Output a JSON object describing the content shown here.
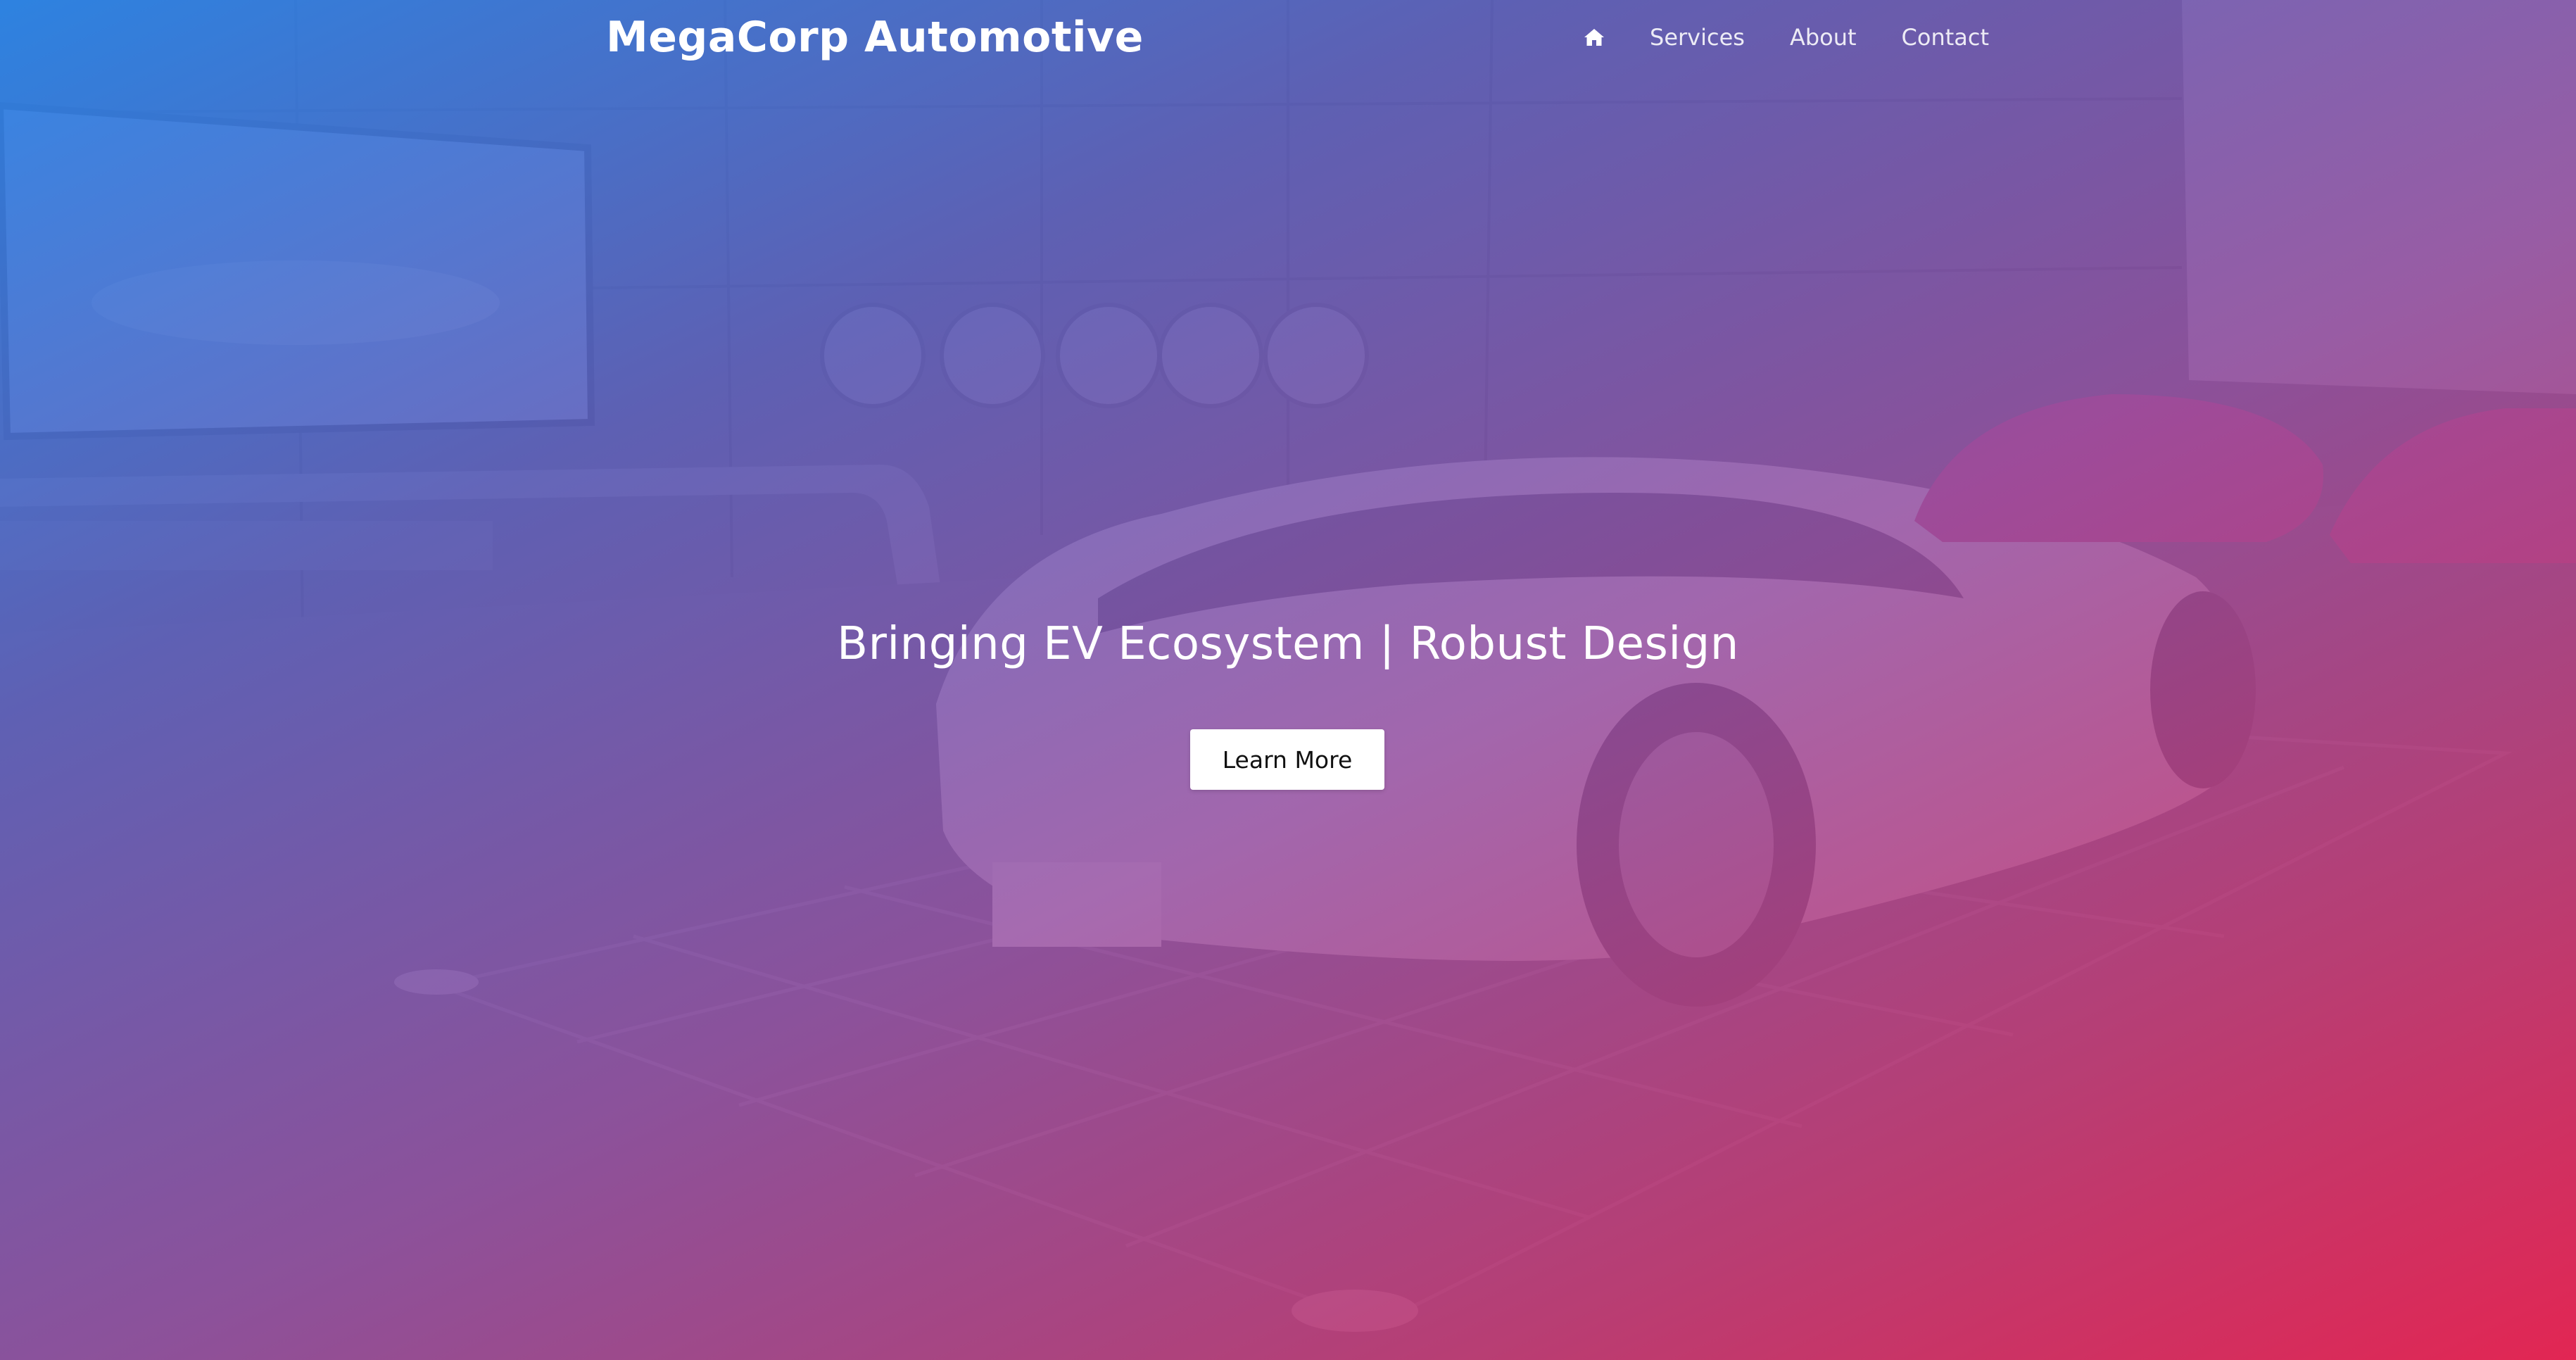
{
  "brand": {
    "name": "MegaCorp Automotive"
  },
  "nav": {
    "home_icon": "home-icon",
    "links": [
      {
        "label": "Services"
      },
      {
        "label": "About"
      },
      {
        "label": "Contact"
      }
    ]
  },
  "hero": {
    "headline": "Bringing EV Ecosystem | Robust Design",
    "cta_label": "Learn More",
    "gradient": {
      "start": "#2884e8",
      "mid": "#9646a0",
      "end": "#e82250"
    }
  }
}
